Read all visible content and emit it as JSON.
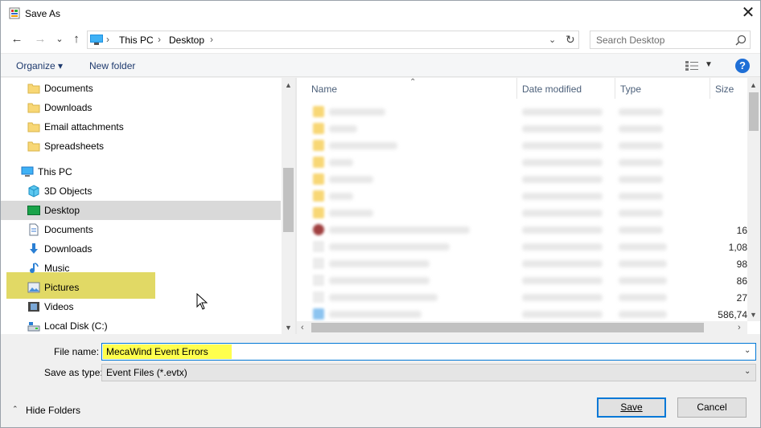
{
  "window": {
    "title": "Save As",
    "close_glyph": "✕"
  },
  "nav": {
    "back_glyph": "←",
    "forward_glyph": "→",
    "recent_glyph": "⌄",
    "up_glyph": "↑"
  },
  "address": {
    "crumbs": [
      "This PC",
      "Desktop"
    ],
    "separator": "›",
    "dropdown_glyph": "⌄",
    "refresh_glyph": "↻"
  },
  "search": {
    "placeholder": "Search Desktop"
  },
  "toolbar": {
    "organize_label": "Organize ▾",
    "new_folder_label": "New folder",
    "view_dropdown_glyph": "▼",
    "help_glyph": "?"
  },
  "sidebar": {
    "quick_items": [
      {
        "label": "Documents",
        "icon": "folder-icon"
      },
      {
        "label": "Downloads",
        "icon": "folder-icon"
      },
      {
        "label": "Email attachments",
        "icon": "folder-icon"
      },
      {
        "label": "Spreadsheets",
        "icon": "folder-icon"
      }
    ],
    "this_pc_label": "This PC",
    "pc_items": [
      {
        "label": "3D Objects",
        "icon": "3d-objects-icon"
      },
      {
        "label": "Desktop",
        "icon": "desktop-icon",
        "selected": true
      },
      {
        "label": "Documents",
        "icon": "document-icon"
      },
      {
        "label": "Downloads",
        "icon": "download-icon"
      },
      {
        "label": "Music",
        "icon": "music-icon"
      },
      {
        "label": "Pictures",
        "icon": "pictures-icon"
      },
      {
        "label": "Videos",
        "icon": "video-icon"
      },
      {
        "label": "Local Disk (C:)",
        "icon": "drive-icon"
      }
    ]
  },
  "files": {
    "columns": {
      "name": "Name",
      "date": "Date modified",
      "type": "Type",
      "size": "Size"
    },
    "sizes": [
      "16",
      "1,08",
      "98",
      "86",
      "27",
      "586,74"
    ]
  },
  "bottom": {
    "file_name_label": "File name:",
    "file_name_value": "MecaWind Event Errors",
    "save_type_label": "Save as type:",
    "save_type_value": "Event Files (*.evtx)",
    "dropdown_glyph": "⌄",
    "hide_folders_label": "Hide Folders",
    "hide_folders_glyph": "⌃",
    "save_label": "Save",
    "cancel_label": "Cancel"
  },
  "colors": {
    "accent": "#0078d7",
    "highlight": "#dcd24a",
    "filename_highlight": "#ffff4d",
    "selection": "#d9d9d9"
  }
}
